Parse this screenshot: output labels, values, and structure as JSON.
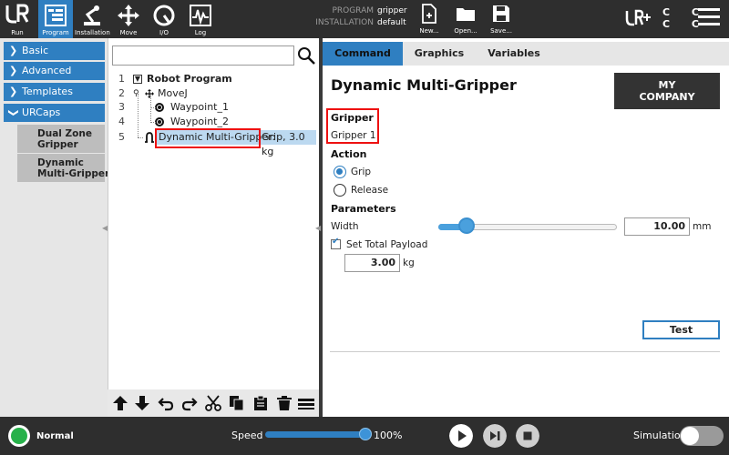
{
  "header": {
    "nav": [
      {
        "label": "Run",
        "icon": "ur-logo-icon"
      },
      {
        "label": "Program",
        "icon": "program-icon",
        "active": true
      },
      {
        "label": "Installation",
        "icon": "robot-arm-icon"
      },
      {
        "label": "Move",
        "icon": "move-arrows-icon"
      },
      {
        "label": "I/O",
        "icon": "io-gauge-icon"
      },
      {
        "label": "Log",
        "icon": "log-graph-icon"
      }
    ],
    "program_key": "PROGRAM",
    "program_value": "gripper",
    "installation_key": "INSTALLATION",
    "installation_value": "default",
    "file_buttons": [
      {
        "label": "New...",
        "icon": "new-file-icon"
      },
      {
        "label": "Open...",
        "icon": "open-folder-icon"
      },
      {
        "label": "Save...",
        "icon": "save-icon"
      }
    ],
    "cc": "C C\nC C"
  },
  "sidebar": {
    "items": [
      {
        "label": "Basic"
      },
      {
        "label": "Advanced"
      },
      {
        "label": "Templates"
      },
      {
        "label": "URCaps"
      }
    ],
    "sub_items": [
      {
        "label": "Dual Zone\nGripper"
      },
      {
        "label": "Dynamic\nMulti-Gripper"
      }
    ]
  },
  "tree": {
    "rows": [
      {
        "num": "1",
        "label": "Robot Program"
      },
      {
        "num": "2",
        "label": "MoveJ"
      },
      {
        "num": "3",
        "label": "Waypoint_1"
      },
      {
        "num": "4",
        "label": "Waypoint_2"
      },
      {
        "num": "5",
        "label": "Dynamic Multi-Gripper:",
        "suffix": "Grip, 3.0 kg"
      }
    ]
  },
  "tabs": [
    {
      "label": "Command",
      "active": true
    },
    {
      "label": "Graphics"
    },
    {
      "label": "Variables"
    }
  ],
  "main": {
    "title": "Dynamic Multi-Gripper",
    "company_button": "MY\nCOMPANY",
    "gripper_heading": "Gripper",
    "gripper_value": "Gripper 1",
    "action_heading": "Action",
    "action_options": [
      "Grip",
      "Release"
    ],
    "action_selected": "Grip",
    "parameters_heading": "Parameters",
    "width_label": "Width",
    "width_value": "10.00",
    "width_unit": "mm",
    "width_slider_fraction": 0.16,
    "payload_label": "Set Total Payload",
    "payload_checked": true,
    "payload_value": "3.00",
    "payload_unit": "kg",
    "test_button": "Test"
  },
  "footer": {
    "status": "Normal",
    "speed_label": "Speed",
    "speed_value": "100%",
    "simulation_label": "Simulation",
    "simulation_on": false
  },
  "colors": {
    "accent": "#2f7fc1",
    "header_bg": "#2e2e2e",
    "status_green": "#27b14a",
    "highlight_red": "#ee1111"
  }
}
